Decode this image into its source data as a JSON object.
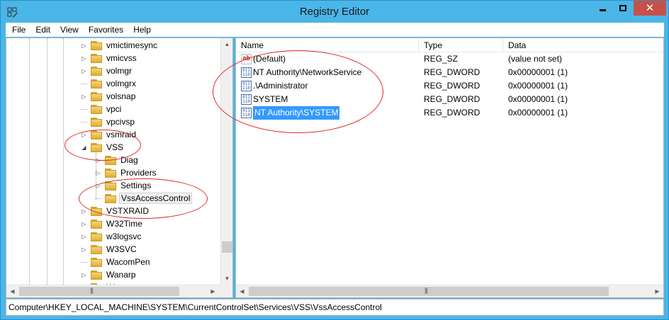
{
  "window": {
    "title": "Registry Editor"
  },
  "menu": [
    "File",
    "Edit",
    "View",
    "Favorites",
    "Help"
  ],
  "tree": [
    {
      "label": "vmictimesync",
      "expander": "collapsed"
    },
    {
      "label": "vmicvss",
      "expander": "collapsed"
    },
    {
      "label": "volmgr",
      "expander": "collapsed"
    },
    {
      "label": "volmgrx",
      "expander": "none"
    },
    {
      "label": "volsnap",
      "expander": "collapsed"
    },
    {
      "label": "vpci",
      "expander": "none"
    },
    {
      "label": "vpcivsp",
      "expander": "none"
    },
    {
      "label": "vsmraid",
      "expander": "collapsed"
    },
    {
      "label": "VSS",
      "expander": "expanded"
    },
    {
      "label": "Diag",
      "expander": "collapsed",
      "child": true
    },
    {
      "label": "Providers",
      "expander": "collapsed",
      "child": true
    },
    {
      "label": "Settings",
      "expander": "collapsed",
      "child": true
    },
    {
      "label": "VssAccessControl",
      "expander": "none",
      "child": true,
      "selected": true
    },
    {
      "label": "VSTXRAID",
      "expander": "collapsed"
    },
    {
      "label": "W32Time",
      "expander": "collapsed"
    },
    {
      "label": "w3logsvc",
      "expander": "collapsed"
    },
    {
      "label": "W3SVC",
      "expander": "collapsed"
    },
    {
      "label": "WacomPen",
      "expander": "none"
    },
    {
      "label": "Wanarp",
      "expander": "collapsed"
    },
    {
      "label": "W",
      "expander": "collapsed",
      "partial": true
    }
  ],
  "list": {
    "columns": [
      "Name",
      "Type",
      "Data"
    ],
    "rows": [
      {
        "name": "(Default)",
        "type": "REG_SZ",
        "data": "(value not set)",
        "icon": "string-value-icon"
      },
      {
        "name": "NT Authority\\NetworkService",
        "type": "REG_DWORD",
        "data": "0x00000001 (1)",
        "icon": "binary-value-icon"
      },
      {
        "name": ".\\Administrator",
        "type": "REG_DWORD",
        "data": "0x00000001 (1)",
        "icon": "binary-value-icon"
      },
      {
        "name": "SYSTEM",
        "type": "REG_DWORD",
        "data": "0x00000001 (1)",
        "icon": "binary-value-icon"
      },
      {
        "name": "NT Authority\\SYSTEM",
        "type": "REG_DWORD",
        "data": "0x00000001 (1)",
        "icon": "binary-value-icon",
        "selected": true
      }
    ]
  },
  "icons": {
    "string_glyph": "ab",
    "binary_glyph": "011 110"
  },
  "statusbar": {
    "path": "Computer\\HKEY_LOCAL_MACHINE\\SYSTEM\\CurrentControlSet\\Services\\VSS\\VssAccessControl"
  },
  "colors": {
    "titlebar": "#4ab6e8",
    "close": "#c7504a",
    "selection": "#3399ff",
    "annotation": "#e0282c"
  }
}
